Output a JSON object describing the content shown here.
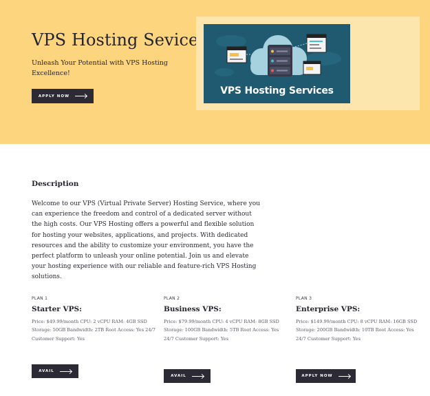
{
  "hero": {
    "title": "VPS Hosting Sevice",
    "subtitle": "Unleash Your Potential with VPS Hosting Excellence!",
    "cta_label": "APPLY NOW",
    "banner_text": "VPS Hosting Services"
  },
  "description": {
    "title": "Description",
    "body": "Welcome to our VPS (Virtual Private Server) Hosting Service, where you can experience the freedom and control of a dedicated server without the high costs. Our VPS Hosting offers a powerful and flexible solution for hosting your websites, applications, and projects. With dedicated resources and the ability to customize your environment, you have the perfect platform to unleash your online potential. Join us and elevate your hosting experience with our reliable and feature-rich VPS Hosting solutions."
  },
  "plans": [
    {
      "number": "PLAN 1",
      "name": "Starter VPS:",
      "details": "Price: $49.99/month CPU: 2 vCPU RAM: 4GB SSD Storage: 50GB Bandwidth: 2TB Root Access: Yes 24/7 Customer Support: Yes",
      "button": "AVAIL"
    },
    {
      "number": "PLAN 2",
      "name": "Business VPS:",
      "details": "Price: $79.99/month CPU: 4 vCPU RAM: 8GB SSD Storage: 100GB Bandwidth: 5TB Root Access: Yes 24/7 Customer Support: Yes",
      "button": "AVAIL"
    },
    {
      "number": "PLAN 3",
      "name": "Enterprise VPS:",
      "details": "Price: $149.99/month CPU: 8 vCPU RAM: 16GB SSD Storage: 200GB Bandwidth: 10TB Root Access: Yes 24/7 Customer Support: Yes",
      "button": "APPLY NOW"
    }
  ],
  "colors": {
    "hero_bg": "#fcd57e",
    "media_bg": "#fde6ad",
    "button_bg": "#2b2a35",
    "banner_bg": "#1f5a70"
  }
}
